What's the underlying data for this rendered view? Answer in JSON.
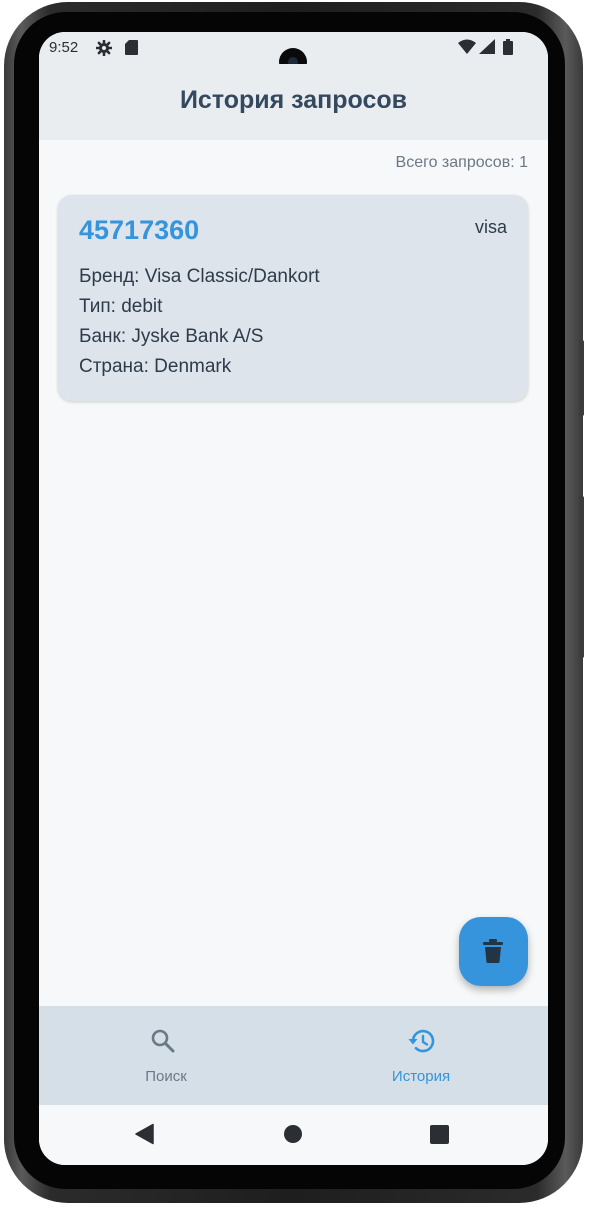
{
  "status_bar": {
    "time": "9:52",
    "icons": [
      "gear-icon",
      "sd-card-icon",
      "wifi-icon",
      "signal-icon",
      "battery-icon"
    ]
  },
  "app_bar": {
    "title": "История запросов"
  },
  "history": {
    "total_label": "Всего запросов: 1",
    "items": [
      {
        "number": "45717360",
        "scheme": "visa",
        "brand": "Бренд: Visa Classic/Dankort",
        "type": "Тип: debit",
        "bank": "Банк: Jyske Bank A/S",
        "country": "Страна: Denmark"
      }
    ]
  },
  "fab": {
    "icon": "delete-icon"
  },
  "bottom_nav": {
    "items": [
      {
        "label": "Поиск",
        "icon": "search-icon",
        "active": false
      },
      {
        "label": "История",
        "icon": "history-icon",
        "active": true
      }
    ]
  },
  "system_nav": {
    "icons": [
      "back-icon",
      "home-icon",
      "recents-icon"
    ]
  },
  "colors": {
    "accent": "#3594dc",
    "title": "#34495e",
    "card_bg": "#dde4ec",
    "nav_bg": "#d4dfe8",
    "inactive": "#6b7887"
  }
}
